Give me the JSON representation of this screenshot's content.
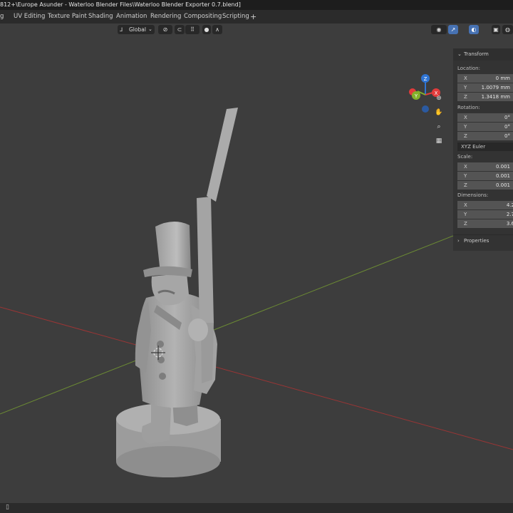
{
  "window": {
    "title": "812+\\Europe Asunder - Waterloo Blender Files\\Waterloo Blender Exporter 0.7.blend]"
  },
  "workspace_tabs": [
    "g",
    "UV Editing",
    "Texture Paint",
    "Shading",
    "Animation",
    "Rendering",
    "Compositing",
    "Scripting",
    "+"
  ],
  "viewport_header": {
    "orientation": "Global",
    "icons": [
      "transform-orientation-icon",
      "pivot-point-icon",
      "snap-magnet-icon",
      "snap-increment-icon",
      "proportional-edit-icon",
      "falloff-icon",
      "visibility-icon",
      "gizmo-icon",
      "overlay-icon",
      "xray-icon",
      "solid-shading-icon"
    ]
  },
  "navigation_gizmo": {
    "axes": [
      "Z",
      "Y",
      "X"
    ],
    "colors": {
      "x": "#e23b3b",
      "y": "#83b22b",
      "z": "#2f74d3",
      "neg_y": "#5a7a2a",
      "neg_z": "#2b5aa0"
    }
  },
  "nav_buttons": [
    "zoom-icon",
    "hand-pan-icon",
    "camera-icon",
    "grid-ortho-icon"
  ],
  "n_panel": {
    "section": "Transform",
    "location_label": "Location:",
    "location": [
      {
        "axis": "X",
        "value": "0 mm"
      },
      {
        "axis": "Y",
        "value": "1.0079 mm"
      },
      {
        "axis": "Z",
        "value": "1.3418 mm"
      }
    ],
    "rotation_label": "Rotation:",
    "rotation": [
      {
        "axis": "X",
        "value": "0°"
      },
      {
        "axis": "Y",
        "value": "0°"
      },
      {
        "axis": "Z",
        "value": "0°"
      }
    ],
    "rotation_mode": "XYZ Euler",
    "scale_label": "Scale:",
    "scale": [
      {
        "axis": "X",
        "value": "0.001"
      },
      {
        "axis": "Y",
        "value": "0.001"
      },
      {
        "axis": "Z",
        "value": "0.001"
      }
    ],
    "dimensions_label": "Dimensions:",
    "dimensions": [
      {
        "axis": "X",
        "value": "4.2"
      },
      {
        "axis": "Y",
        "value": "2.7"
      },
      {
        "axis": "Z",
        "value": "3.6"
      }
    ],
    "properties_label": "Properties"
  },
  "colors": {
    "viewport_bg": "#3d3d3d",
    "x_axis_line": "#9a3535",
    "y_axis_line": "#6b8a34",
    "model": "#a9a9a9",
    "active_button": "#4772b3"
  }
}
